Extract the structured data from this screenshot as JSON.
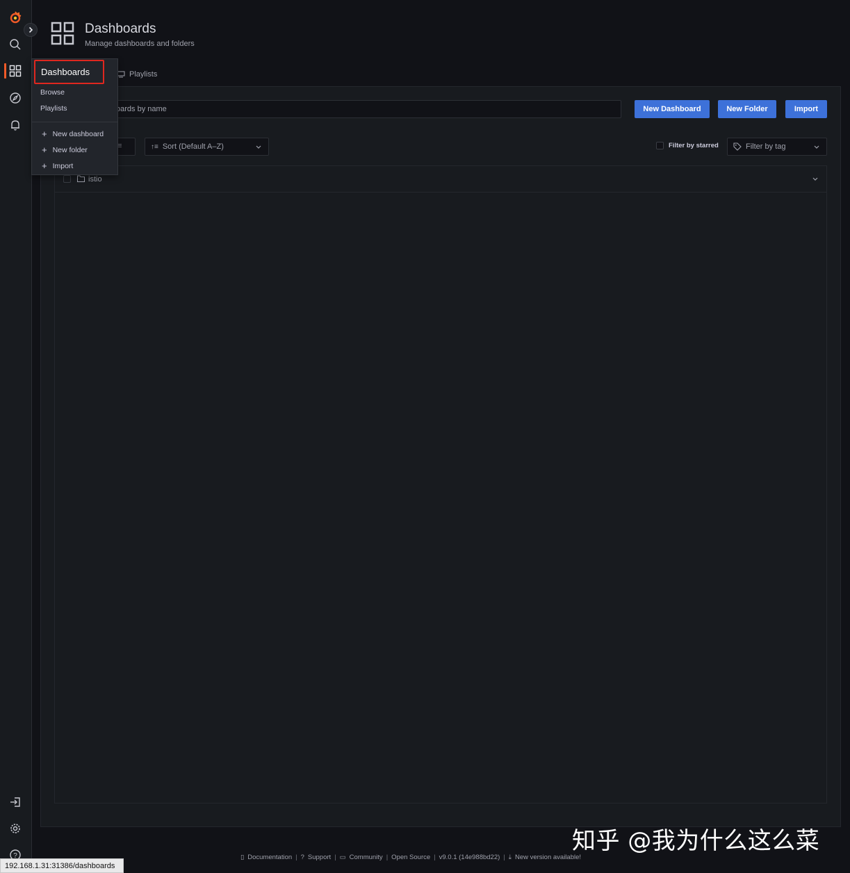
{
  "header": {
    "title": "Dashboards",
    "subtitle": "Manage dashboards and folders"
  },
  "tabs": {
    "playlists": "Playlists"
  },
  "search": {
    "placeholder_visible": "oards by name"
  },
  "buttons": {
    "new_dashboard": "New Dashboard",
    "new_folder": "New Folder",
    "import": "Import"
  },
  "filters": {
    "sort": "Sort (Default A–Z)",
    "starred": "Filter by starred",
    "tag": "Filter by tag"
  },
  "results": {
    "folder_name": "istio"
  },
  "menu": {
    "header": "Dashboards",
    "items": [
      "Browse",
      "Playlists"
    ],
    "actions": [
      "New dashboard",
      "New folder",
      "Import"
    ]
  },
  "footer": {
    "documentation": "Documentation",
    "support": "Support",
    "community": "Community",
    "open_source": "Open Source",
    "version": "v9.0.1 (14e988bd22)",
    "new_version": "New version available!"
  },
  "watermark": "知乎 @我为什么这么菜",
  "status_url": "192.168.1.31:31386/dashboards",
  "colors": {
    "accent": "#3d71d9",
    "brand": "#f05a28",
    "highlight": "#e0271f"
  }
}
